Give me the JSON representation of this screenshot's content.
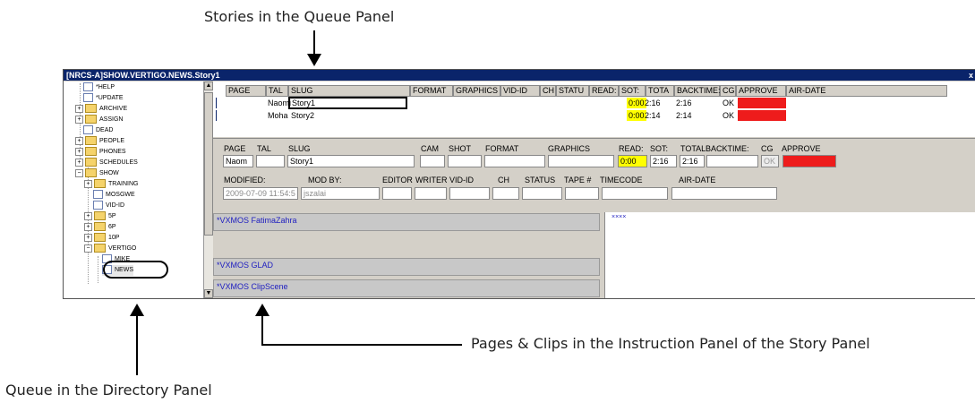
{
  "callouts": {
    "queue_panel": "Stories in the Queue Panel",
    "instruction_panel": "Pages & Clips in the Instruction Panel of the Story Panel",
    "directory_panel": "Queue in the Directory Panel"
  },
  "window": {
    "title": "[NRCS-A]SHOW.VERTIGO.NEWS.Story1",
    "close_label": "x"
  },
  "directory": {
    "items": [
      {
        "label": "*HELP",
        "type": "queue"
      },
      {
        "label": "*UPDATE",
        "type": "queue"
      },
      {
        "label": "ARCHIVE",
        "type": "folder"
      },
      {
        "label": "ASSIGN",
        "type": "folder"
      },
      {
        "label": "DEAD",
        "type": "queue"
      },
      {
        "label": "PEOPLE",
        "type": "folder"
      },
      {
        "label": "PHONES",
        "type": "folder"
      },
      {
        "label": "SCHEDULES",
        "type": "folder"
      },
      {
        "label": "SHOW",
        "type": "folder"
      },
      {
        "label": "TRAINING",
        "type": "folder"
      },
      {
        "label": "MOSGWE",
        "type": "queue"
      },
      {
        "label": "VID-ID",
        "type": "queue"
      },
      {
        "label": "5P",
        "type": "folder"
      },
      {
        "label": "6P",
        "type": "folder"
      },
      {
        "label": "10P",
        "type": "folder"
      },
      {
        "label": "VERTIGO",
        "type": "folder"
      },
      {
        "label": "MIKE",
        "type": "queue"
      },
      {
        "label": "NEWS",
        "type": "queue"
      }
    ]
  },
  "queue": {
    "headers": [
      "PAGE",
      "TAL",
      "SLUG",
      "FORMAT",
      "GRAPHICS",
      "VID-ID",
      "CH",
      "STATU",
      "READ:",
      "SOT:",
      "TOTA",
      "BACKTIME:",
      "CG",
      "APPROVE",
      "AIR-DATE"
    ],
    "rows": [
      {
        "tal": "Naomi",
        "slug": "Story1",
        "read": "0:00",
        "sot": "2:16",
        "total": "2:16",
        "cg": "OK"
      },
      {
        "tal": "Moha",
        "slug": "Story2",
        "read": "0:00",
        "sot": "2:14",
        "total": "2:14",
        "cg": "OK"
      }
    ]
  },
  "story": {
    "row1_labels": {
      "page": "PAGE",
      "tal": "TAL",
      "slug": "SLUG",
      "cam": "CAM",
      "shot": "SHOT",
      "format": "FORMAT",
      "graphics": "GRAPHICS",
      "read": "READ:",
      "sot": "SOT:",
      "total": "TOTAL",
      "backtime": "BACKTIME:",
      "cg": "CG",
      "approve": "APPROVE"
    },
    "row1_values": {
      "page": "Naom",
      "slug": "Story1",
      "read": "0:00",
      "sot": "2:16",
      "total": "2:16",
      "cg": "OK"
    },
    "row2_labels": {
      "modified": "MODIFIED:",
      "modby": "MOD BY:",
      "editor": "EDITOR",
      "writer": "WRITER",
      "vidid": "VID-ID",
      "ch": "CH",
      "status": "STATUS",
      "tape": "TAPE #",
      "timecode": "TIMECODE",
      "airdate": "AIR-DATE"
    },
    "row2_values": {
      "modified": "2009-07-09 11:54:5",
      "modby": "jszalai"
    }
  },
  "instructions": {
    "items": [
      "*VXMOS FatimaZahra",
      "*VXMOS GLAD",
      "*VXMOS ClipScene"
    ],
    "right_marker": "××××"
  },
  "colors": {
    "read_highlight": "#ffff00",
    "approve_red": "#ee1c1c",
    "title_bar": "#0a246a",
    "mos_text": "#2020c0"
  }
}
